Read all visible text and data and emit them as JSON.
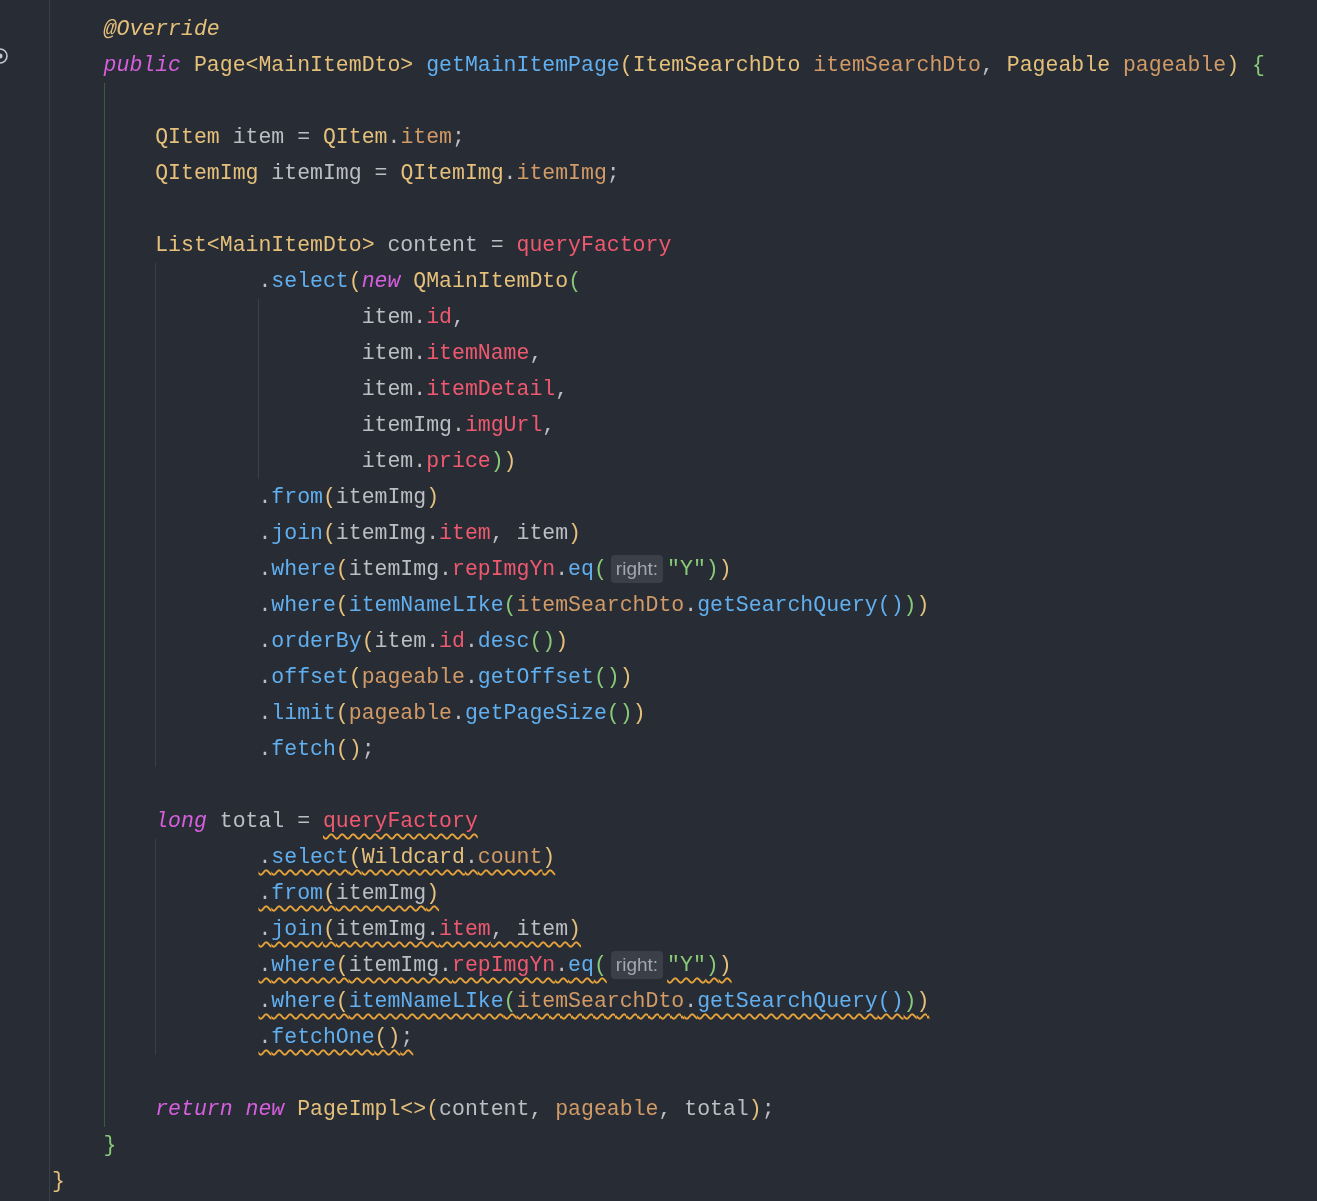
{
  "editor": {
    "lines": [
      {
        "kind": "member",
        "tokens": [
          {
            "text": "@Override",
            "kind": "annotation"
          }
        ]
      },
      {
        "kind": "member",
        "tokens": [
          {
            "text": "public",
            "kind": "keyword"
          },
          {
            "text": " Page<MainItemDto>",
            "kind": "type"
          },
          {
            "text": " getMainItemPage",
            "kind": "method"
          },
          {
            "text": "(",
            "kind": "bracket1"
          },
          {
            "text": "ItemSearchDto",
            "kind": "type"
          },
          {
            "text": " itemSearchDto",
            "kind": "param"
          },
          {
            "text": ", ",
            "kind": "plain"
          },
          {
            "text": "Pageable",
            "kind": "type"
          },
          {
            "text": " pageable",
            "kind": "param"
          },
          {
            "text": ")",
            "kind": "bracket1"
          },
          {
            "text": " {",
            "kind": "bracket2"
          }
        ]
      },
      {
        "kind": "blank"
      },
      {
        "kind": "statement",
        "tokens": [
          {
            "text": "QItem",
            "kind": "type"
          },
          {
            "text": " item = ",
            "kind": "plain"
          },
          {
            "text": "QItem",
            "kind": "type"
          },
          {
            "text": ".",
            "kind": "plain"
          },
          {
            "text": "item",
            "kind": "param"
          },
          {
            "text": ";",
            "kind": "plain"
          }
        ]
      },
      {
        "kind": "statement",
        "tokens": [
          {
            "text": "QItemImg",
            "kind": "type"
          },
          {
            "text": " itemImg = ",
            "kind": "plain"
          },
          {
            "text": "QItemImg",
            "kind": "type"
          },
          {
            "text": ".",
            "kind": "plain"
          },
          {
            "text": "itemImg",
            "kind": "param"
          },
          {
            "text": ";",
            "kind": "plain"
          }
        ]
      },
      {
        "kind": "blank"
      },
      {
        "kind": "statement",
        "tokens": [
          {
            "text": "List<MainItemDto>",
            "kind": "type"
          },
          {
            "text": " content = ",
            "kind": "plain"
          },
          {
            "text": "queryFactory",
            "kind": "field"
          }
        ]
      },
      {
        "kind": "chain",
        "tokens": [
          {
            "text": ".",
            "kind": "plain"
          },
          {
            "text": "select",
            "kind": "method"
          },
          {
            "text": "(",
            "kind": "bracket1"
          },
          {
            "text": "new",
            "kind": "keyword"
          },
          {
            "text": " QMainItemDto",
            "kind": "type"
          },
          {
            "text": "(",
            "kind": "bracket2"
          }
        ]
      },
      {
        "kind": "argument",
        "tokens": [
          {
            "text": "item.",
            "kind": "plain"
          },
          {
            "text": "id",
            "kind": "field"
          },
          {
            "text": ",",
            "kind": "plain"
          }
        ]
      },
      {
        "kind": "argument",
        "tokens": [
          {
            "text": "item.",
            "kind": "plain"
          },
          {
            "text": "itemName",
            "kind": "field"
          },
          {
            "text": ",",
            "kind": "plain"
          }
        ]
      },
      {
        "kind": "argument",
        "tokens": [
          {
            "text": "item.",
            "kind": "plain"
          },
          {
            "text": "itemDetail",
            "kind": "field"
          },
          {
            "text": ",",
            "kind": "plain"
          }
        ]
      },
      {
        "kind": "argument",
        "tokens": [
          {
            "text": "itemImg.",
            "kind": "plain"
          },
          {
            "text": "imgUrl",
            "kind": "field"
          },
          {
            "text": ",",
            "kind": "plain"
          }
        ]
      },
      {
        "kind": "argument",
        "tokens": [
          {
            "text": "item.",
            "kind": "plain"
          },
          {
            "text": "price",
            "kind": "field"
          },
          {
            "text": ")",
            "kind": "bracket2"
          },
          {
            "text": ")",
            "kind": "bracket1"
          }
        ]
      },
      {
        "kind": "chain",
        "tokens": [
          {
            "text": ".",
            "kind": "plain"
          },
          {
            "text": "from",
            "kind": "method"
          },
          {
            "text": "(",
            "kind": "bracket1"
          },
          {
            "text": "itemImg",
            "kind": "plain"
          },
          {
            "text": ")",
            "kind": "bracket1"
          }
        ]
      },
      {
        "kind": "chain",
        "tokens": [
          {
            "text": ".",
            "kind": "plain"
          },
          {
            "text": "join",
            "kind": "method"
          },
          {
            "text": "(",
            "kind": "bracket1"
          },
          {
            "text": "itemImg.",
            "kind": "plain"
          },
          {
            "text": "item",
            "kind": "field"
          },
          {
            "text": ", item",
            "kind": "plain"
          },
          {
            "text": ")",
            "kind": "bracket1"
          }
        ]
      },
      {
        "kind": "chain",
        "tokens": [
          {
            "text": ".",
            "kind": "plain"
          },
          {
            "text": "where",
            "kind": "method"
          },
          {
            "text": "(",
            "kind": "bracket1"
          },
          {
            "text": "itemImg.",
            "kind": "plain"
          },
          {
            "text": "repImgYn",
            "kind": "field"
          },
          {
            "text": ".",
            "kind": "plain"
          },
          {
            "text": "eq",
            "kind": "method"
          },
          {
            "text": "(",
            "kind": "bracket2"
          },
          {
            "text": "right:",
            "kind": "hint"
          },
          {
            "text": "\"Y\"",
            "kind": "string"
          },
          {
            "text": ")",
            "kind": "bracket2"
          },
          {
            "text": ")",
            "kind": "bracket1"
          }
        ]
      },
      {
        "kind": "chain",
        "tokens": [
          {
            "text": ".",
            "kind": "plain"
          },
          {
            "text": "where",
            "kind": "method"
          },
          {
            "text": "(",
            "kind": "bracket1"
          },
          {
            "text": "itemNameLIke",
            "kind": "method"
          },
          {
            "text": "(",
            "kind": "bracket2"
          },
          {
            "text": "itemSearchDto",
            "kind": "param"
          },
          {
            "text": ".",
            "kind": "plain"
          },
          {
            "text": "getSearchQuery",
            "kind": "method"
          },
          {
            "text": "()",
            "kind": "bracket3"
          },
          {
            "text": ")",
            "kind": "bracket2"
          },
          {
            "text": ")",
            "kind": "bracket1"
          }
        ]
      },
      {
        "kind": "chain",
        "tokens": [
          {
            "text": ".",
            "kind": "plain"
          },
          {
            "text": "orderBy",
            "kind": "method"
          },
          {
            "text": "(",
            "kind": "bracket1"
          },
          {
            "text": "item.",
            "kind": "plain"
          },
          {
            "text": "id",
            "kind": "field"
          },
          {
            "text": ".",
            "kind": "plain"
          },
          {
            "text": "desc",
            "kind": "method"
          },
          {
            "text": "()",
            "kind": "bracket2"
          },
          {
            "text": ")",
            "kind": "bracket1"
          }
        ]
      },
      {
        "kind": "chain",
        "tokens": [
          {
            "text": ".",
            "kind": "plain"
          },
          {
            "text": "offset",
            "kind": "method"
          },
          {
            "text": "(",
            "kind": "bracket1"
          },
          {
            "text": "pageable",
            "kind": "param"
          },
          {
            "text": ".",
            "kind": "plain"
          },
          {
            "text": "getOffset",
            "kind": "method"
          },
          {
            "text": "()",
            "kind": "bracket2"
          },
          {
            "text": ")",
            "kind": "bracket1"
          }
        ]
      },
      {
        "kind": "chain",
        "tokens": [
          {
            "text": ".",
            "kind": "plain"
          },
          {
            "text": "limit",
            "kind": "method"
          },
          {
            "text": "(",
            "kind": "bracket1"
          },
          {
            "text": "pageable",
            "kind": "param"
          },
          {
            "text": ".",
            "kind": "plain"
          },
          {
            "text": "getPageSize",
            "kind": "method"
          },
          {
            "text": "()",
            "kind": "bracket2"
          },
          {
            "text": ")",
            "kind": "bracket1"
          }
        ]
      },
      {
        "kind": "chain",
        "tokens": [
          {
            "text": ".",
            "kind": "plain"
          },
          {
            "text": "fetch",
            "kind": "method"
          },
          {
            "text": "()",
            "kind": "bracket1"
          },
          {
            "text": ";",
            "kind": "plain"
          }
        ]
      },
      {
        "kind": "blank"
      },
      {
        "kind": "statement",
        "tokens": [
          {
            "text": "long",
            "kind": "keyword"
          },
          {
            "text": " total = ",
            "kind": "plain"
          },
          {
            "text": "queryFactory",
            "kind": "field",
            "warning": true
          }
        ]
      },
      {
        "kind": "chain",
        "warning": true,
        "tokens": [
          {
            "text": ".",
            "kind": "plain"
          },
          {
            "text": "select",
            "kind": "method"
          },
          {
            "text": "(",
            "kind": "bracket1"
          },
          {
            "text": "Wildcard",
            "kind": "type"
          },
          {
            "text": ".",
            "kind": "plain"
          },
          {
            "text": "count",
            "kind": "param"
          },
          {
            "text": ")",
            "kind": "bracket1"
          }
        ]
      },
      {
        "kind": "chain",
        "warning": true,
        "tokens": [
          {
            "text": ".",
            "kind": "plain"
          },
          {
            "text": "from",
            "kind": "method"
          },
          {
            "text": "(",
            "kind": "bracket1"
          },
          {
            "text": "itemImg",
            "kind": "plain"
          },
          {
            "text": ")",
            "kind": "bracket1"
          }
        ]
      },
      {
        "kind": "chain",
        "warning": true,
        "tokens": [
          {
            "text": ".",
            "kind": "plain"
          },
          {
            "text": "join",
            "kind": "method"
          },
          {
            "text": "(",
            "kind": "bracket1"
          },
          {
            "text": "itemImg.",
            "kind": "plain"
          },
          {
            "text": "item",
            "kind": "field"
          },
          {
            "text": ", item",
            "kind": "plain"
          },
          {
            "text": ")",
            "kind": "bracket1"
          }
        ]
      },
      {
        "kind": "chain",
        "warning": true,
        "tokens": [
          {
            "text": ".",
            "kind": "plain"
          },
          {
            "text": "where",
            "kind": "method"
          },
          {
            "text": "(",
            "kind": "bracket1"
          },
          {
            "text": "itemImg.",
            "kind": "plain"
          },
          {
            "text": "repImgYn",
            "kind": "field"
          },
          {
            "text": ".",
            "kind": "plain"
          },
          {
            "text": "eq",
            "kind": "method"
          },
          {
            "text": "(",
            "kind": "bracket2"
          },
          {
            "text": "right:",
            "kind": "hint"
          },
          {
            "text": "\"Y\"",
            "kind": "string"
          },
          {
            "text": ")",
            "kind": "bracket2"
          },
          {
            "text": ")",
            "kind": "bracket1"
          }
        ]
      },
      {
        "kind": "chain",
        "warning": true,
        "tokens": [
          {
            "text": ".",
            "kind": "plain"
          },
          {
            "text": "where",
            "kind": "method"
          },
          {
            "text": "(",
            "kind": "bracket1"
          },
          {
            "text": "itemNameLIke",
            "kind": "method"
          },
          {
            "text": "(",
            "kind": "bracket2"
          },
          {
            "text": "itemSearchDto",
            "kind": "param"
          },
          {
            "text": ".",
            "kind": "plain"
          },
          {
            "text": "getSearchQuery",
            "kind": "method"
          },
          {
            "text": "()",
            "kind": "bracket3"
          },
          {
            "text": ")",
            "kind": "bracket2"
          },
          {
            "text": ")",
            "kind": "bracket1"
          }
        ]
      },
      {
        "kind": "chain",
        "warning": true,
        "tokens": [
          {
            "text": ".",
            "kind": "plain"
          },
          {
            "text": "fetchOne",
            "kind": "method"
          },
          {
            "text": "()",
            "kind": "bracket1"
          },
          {
            "text": ";",
            "kind": "plain"
          }
        ]
      },
      {
        "kind": "blank"
      },
      {
        "kind": "statement",
        "tokens": [
          {
            "text": "return",
            "kind": "keyword"
          },
          {
            "text": " new",
            "kind": "keyword"
          },
          {
            "text": " PageImpl<>",
            "kind": "type"
          },
          {
            "text": "(",
            "kind": "bracket1"
          },
          {
            "text": "content, ",
            "kind": "plain"
          },
          {
            "text": "pageable",
            "kind": "param"
          },
          {
            "text": ", total",
            "kind": "plain"
          },
          {
            "text": ")",
            "kind": "bracket1"
          },
          {
            "text": ";",
            "kind": "plain"
          }
        ]
      },
      {
        "kind": "member",
        "tokens": [
          {
            "text": "}",
            "kind": "bracket2"
          }
        ]
      },
      {
        "kind": "top",
        "tokens": [
          {
            "text": "}",
            "kind": "bracket1"
          }
        ]
      }
    ]
  }
}
